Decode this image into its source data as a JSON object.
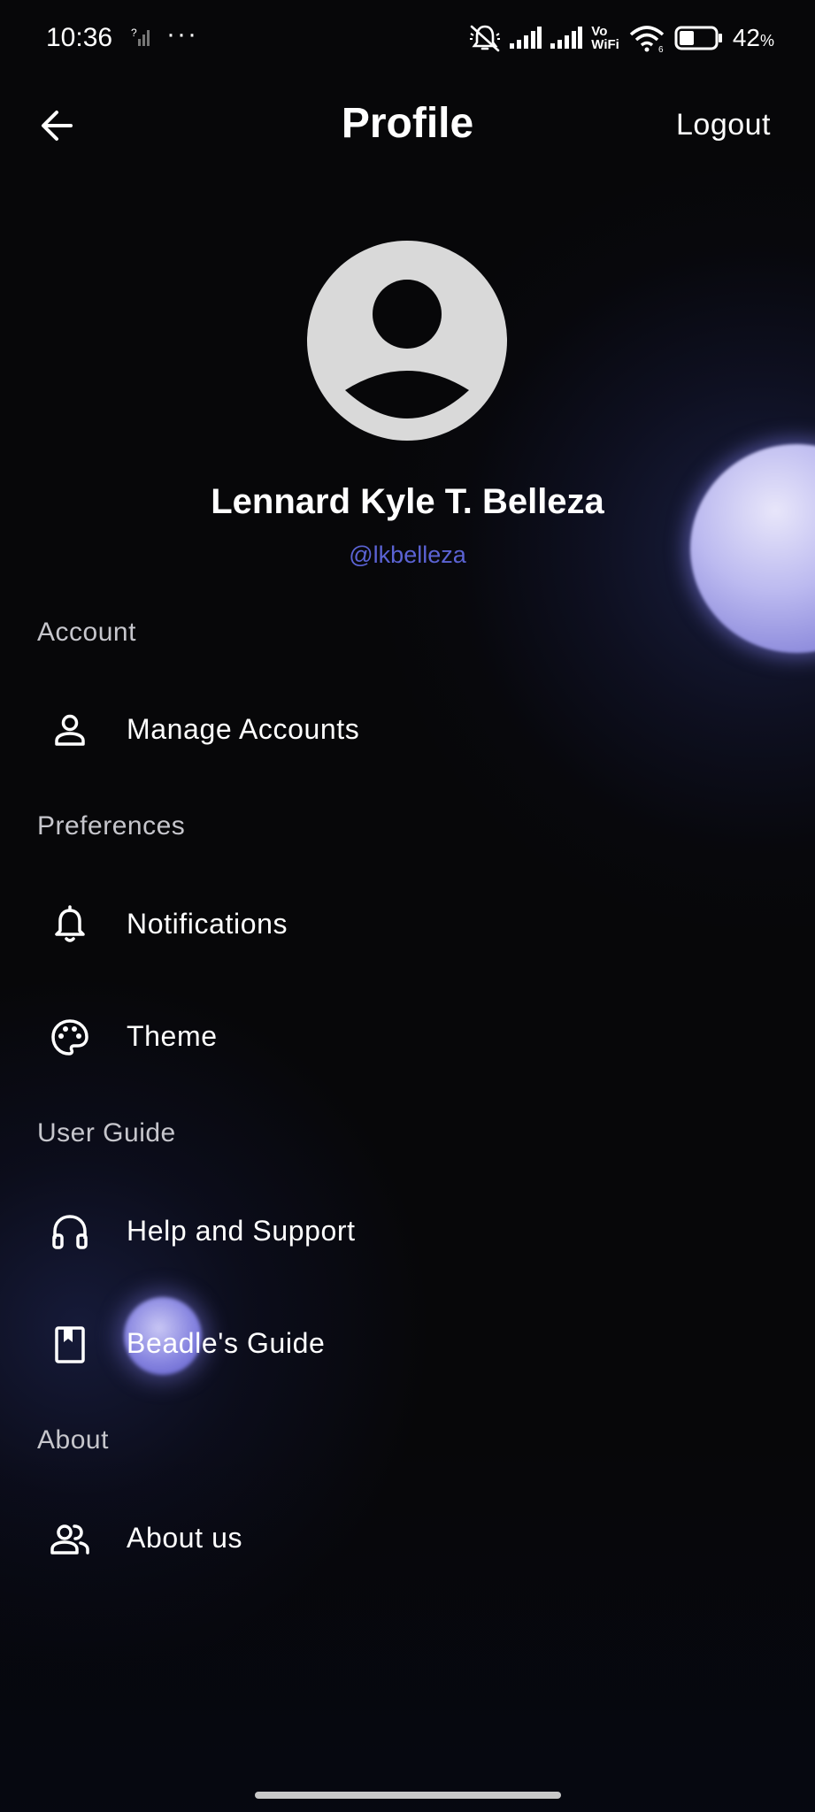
{
  "status_bar": {
    "time": "10:36",
    "overflow": "···",
    "vowifi_line1": "Vo",
    "vowifi_line2": "WiFi",
    "battery_percent": "42",
    "battery_unit": "%",
    "battery_level": 0.42,
    "icons": [
      "sim-no-service-icon",
      "muted-bell-icon",
      "signal-icon",
      "signal-icon",
      "wifi-icon",
      "battery-icon"
    ]
  },
  "header": {
    "title": "Profile",
    "logout_label": "Logout",
    "back_icon": "arrow-left-icon"
  },
  "profile": {
    "name": "Lennard Kyle T. Belleza",
    "handle": "@lkbelleza",
    "handle_color": "#5b63d4"
  },
  "sections": {
    "account": {
      "title": "Account",
      "items": [
        {
          "label": "Manage Accounts",
          "icon": "person-icon"
        }
      ]
    },
    "preferences": {
      "title": "Preferences",
      "items": [
        {
          "label": "Notifications",
          "icon": "bell-icon"
        },
        {
          "label": "Theme",
          "icon": "palette-icon"
        }
      ]
    },
    "user_guide": {
      "title": "User Guide",
      "items": [
        {
          "label": "Help and Support",
          "icon": "headphones-icon"
        },
        {
          "label": "Beadle's Guide",
          "icon": "book-icon"
        }
      ]
    },
    "about": {
      "title": "About",
      "items": [
        {
          "label": "About us",
          "icon": "people-icon"
        }
      ]
    }
  },
  "colors": {
    "background": "#070709",
    "accent": "#5b63d4",
    "orb": "#bcbaf0"
  }
}
